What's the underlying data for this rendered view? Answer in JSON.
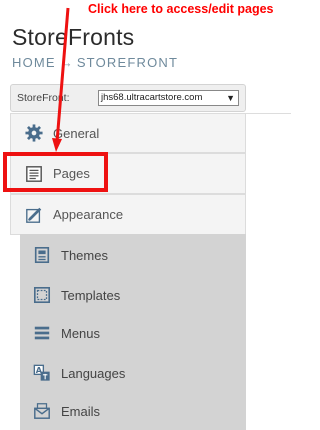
{
  "annotation": "Click here to access/edit pages",
  "header": {
    "title": "StoreFronts",
    "breadcrumb_home": "HOME",
    "breadcrumb_sep": "→",
    "breadcrumb_current": "STOREFRONT"
  },
  "selector": {
    "label": "StoreFront:",
    "value": "jhs68.ultracartstore.com"
  },
  "nav": {
    "items": [
      {
        "label": "General",
        "icon": "gear-icon"
      },
      {
        "label": "Pages",
        "icon": "pages-icon"
      },
      {
        "label": "Appearance",
        "icon": "paintbrush-icon"
      }
    ],
    "appearance_sub": [
      {
        "label": "Themes",
        "icon": "themes-icon"
      },
      {
        "label": "Templates",
        "icon": "templates-icon"
      },
      {
        "label": "Menus",
        "icon": "menu-icon"
      },
      {
        "label": "Languages",
        "icon": "languages-icon"
      },
      {
        "label": "Emails",
        "icon": "email-icon"
      }
    ]
  },
  "colors": {
    "annotation": "#ff0000",
    "highlight": "#ee1111",
    "icon": "#4a6d8c"
  }
}
